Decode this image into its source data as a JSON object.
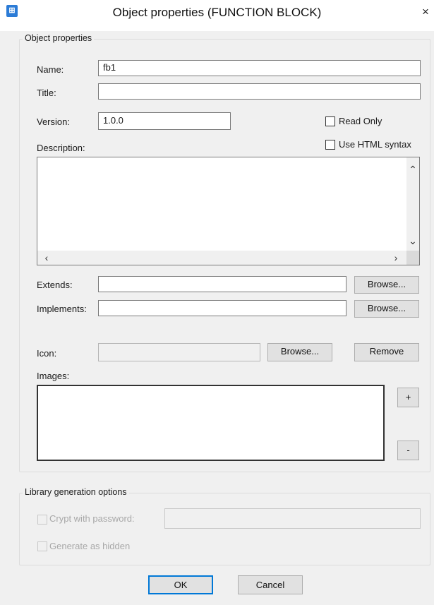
{
  "window": {
    "title": "Object properties (FUNCTION BLOCK)",
    "app_icon": "function-block-icon",
    "close_glyph": "×"
  },
  "object_properties": {
    "legend": "Object properties",
    "name": {
      "label": "Name:",
      "value": "fb1"
    },
    "title": {
      "label": "Title:",
      "value": ""
    },
    "version": {
      "label": "Version:",
      "value": "1.0.0"
    },
    "read_only": {
      "label": "Read Only",
      "checked": false
    },
    "use_html": {
      "label": "Use HTML syntax",
      "checked": false
    },
    "description": {
      "label": "Description:",
      "value": ""
    },
    "extends": {
      "label": "Extends:",
      "value": "",
      "browse": "Browse..."
    },
    "implements": {
      "label": "Implements:",
      "value": "",
      "browse": "Browse..."
    },
    "icon": {
      "label": "Icon:",
      "value": "",
      "browse": "Browse...",
      "remove": "Remove"
    },
    "images": {
      "label": "Images:",
      "add": "+",
      "remove": "-"
    }
  },
  "library_options": {
    "legend": "Library generation options",
    "crypt": {
      "label": "Crypt with password:",
      "checked": false,
      "enabled": false,
      "value": ""
    },
    "hidden": {
      "label": "Generate as hidden",
      "checked": false,
      "enabled": false
    }
  },
  "footer": {
    "ok": "OK",
    "cancel": "Cancel"
  },
  "colors": {
    "accent": "#2b7bd6",
    "disabled_text": "#a8a8a8",
    "background": "#f0f0f0"
  }
}
